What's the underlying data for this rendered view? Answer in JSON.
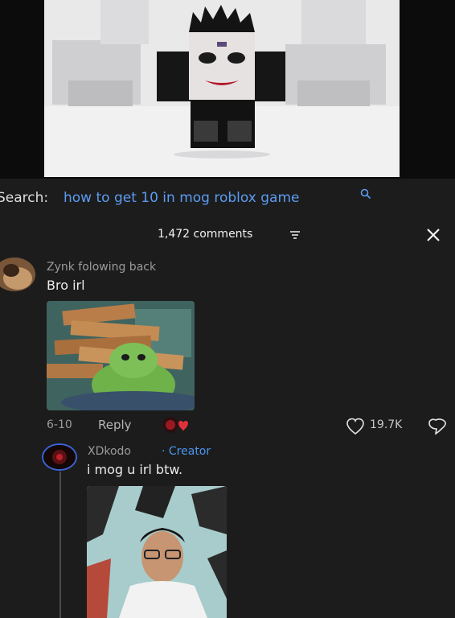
{
  "search": {
    "prefix": "Search:",
    "query": "how to get 10 in mog roblox game"
  },
  "comments_header": {
    "count_label": "1,472 comments"
  },
  "comments": [
    {
      "author": "Zynk folowing back",
      "text": "Bro irl",
      "date": "6-10",
      "reply_label": "Reply",
      "likes": "19.7K"
    },
    {
      "author": "XDkodo",
      "badge": "· Creator",
      "text": "i mog u irl btw."
    }
  ],
  "icons": {
    "search": "search-icon",
    "sort": "sort-icon",
    "close": "close-icon",
    "like": "heart-icon",
    "dislike": "dislike-icon"
  },
  "colors": {
    "background": "#1c1c1d",
    "link_blue": "#5c9cf0",
    "creator_blue": "#4a96f0"
  }
}
